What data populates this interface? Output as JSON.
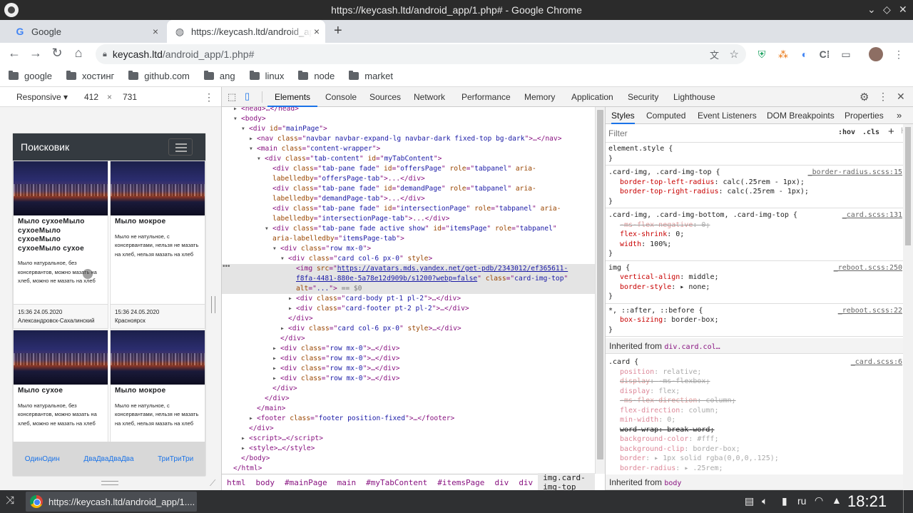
{
  "window": {
    "title": "https://keycash.ltd/android_app/1.php# - Google Chrome"
  },
  "tabs": [
    {
      "label": "Google",
      "close": "×"
    },
    {
      "label": "https://keycash.ltd/android_app/1.php#",
      "close": "×"
    }
  ],
  "new_tab": "+",
  "address": {
    "host": "keycash.ltd",
    "path": "/android_app/1.php#"
  },
  "bookmarks": [
    "google",
    "хостинг",
    "github.com",
    "ang",
    "linux",
    "node",
    "market"
  ],
  "device": {
    "mode": "Responsive",
    "width": "412",
    "x": "×",
    "height": "731"
  },
  "phone": {
    "brand": "Поисковик",
    "cards": [
      {
        "title": "Мыло сухоеМыло сухоеМыло сухоеМыло сухоеМыло сухое",
        "text": "Мыло натуральное, без консервантов, можно мазать на хлеб, можно не мазать на хлеб",
        "date": "15:36 24.05.2020",
        "city": "Александровск-Сахалинский"
      },
      {
        "title": "Мыло мокрое",
        "text": "Мыло не натульное, с консервантами, нельзя не мазать на хлеб, нельзя мазать на хлеб",
        "date": "15:36 24.05.2020",
        "city": "Красноярск"
      },
      {
        "title": "Мыло сухое",
        "text": "Мыло натуральное, без консервантов, можно мазать на хлеб, можно не мазать на хлеб"
      },
      {
        "title": "Мыло мокрое",
        "text": "Мыло не натульное, с консервантами, нельзя не мазать на хлеб, нельзя мазать на хлеб"
      }
    ],
    "bottom_links": [
      "ОдинОдин",
      "ДваДваДваДва",
      "ТриТриТри"
    ]
  },
  "devtools": {
    "tabs": [
      "Elements",
      "Console",
      "Sources",
      "Network",
      "Performance",
      "Memory",
      "Application",
      "Security",
      "Lighthouse"
    ],
    "active_tab": "Elements",
    "dom_lines": [
      {
        "i": 0,
        "tri": "▸",
        "html": "<span class='t'>&lt;head&gt;</span>…<span class='t'>&lt;/head&gt;</span>"
      },
      {
        "i": 0,
        "tri": "▾",
        "html": "<span class='t'>&lt;body&gt;</span>"
      },
      {
        "i": 1,
        "tri": "▾",
        "html": "<span class='t'>&lt;div </span><span class='an'>id</span>=\"<span class='av'>mainPage</span>\"<span class='t'>&gt;</span>"
      },
      {
        "i": 2,
        "tri": "▸",
        "html": "<span class='t'>&lt;nav </span><span class='an'>class</span>=\"<span class='av'>navbar navbar-expand-lg navbar-dark fixed-top bg-dark</span>\"<span class='t'>&gt;</span>…<span class='t'>&lt;/nav&gt;</span>"
      },
      {
        "i": 2,
        "tri": "▾",
        "html": "<span class='t'>&lt;main </span><span class='an'>class</span>=\"<span class='av'>content-wrapper</span>\"<span class='t'>&gt;</span>"
      },
      {
        "i": 3,
        "tri": "▾",
        "html": "<span class='t'>&lt;div </span><span class='an'>class</span>=\"<span class='av'>tab-content</span>\" <span class='an'>id</span>=\"<span class='av'>myTabContent</span>\"<span class='t'>&gt;</span>"
      },
      {
        "i": 4,
        "tri": "",
        "html": "<span class='t'>&lt;div </span><span class='an'>class</span>=\"<span class='av'>tab-pane fade</span>\" <span class='an'>id</span>=\"<span class='av'>offersPage</span>\" <span class='an'>role</span>=\"<span class='av'>tabpanel</span>\" <span class='an'>aria-</span>"
      },
      {
        "i": 4,
        "tri": "",
        "html": "<span class='an'>labelledby</span>=\"<span class='av'>offersPage-tab</span>\"<span class='t'>&gt;</span>...<span class='t'>&lt;/div&gt;</span>"
      },
      {
        "i": 4,
        "tri": "",
        "html": "<span class='t'>&lt;div </span><span class='an'>class</span>=\"<span class='av'>tab-pane fade</span>\" <span class='an'>id</span>=\"<span class='av'>demandPage</span>\" <span class='an'>role</span>=\"<span class='av'>tabpanel</span>\" <span class='an'>aria-</span>"
      },
      {
        "i": 4,
        "tri": "",
        "html": "<span class='an'>labelledby</span>=\"<span class='av'>demandPage-tab</span>\"<span class='t'>&gt;</span>...<span class='t'>&lt;/div&gt;</span>"
      },
      {
        "i": 4,
        "tri": "",
        "html": "<span class='t'>&lt;div </span><span class='an'>class</span>=\"<span class='av'>tab-pane fade</span>\" <span class='an'>id</span>=\"<span class='av'>intersectionPage</span>\" <span class='an'>role</span>=\"<span class='av'>tabpanel</span>\" <span class='an'>aria-</span>"
      },
      {
        "i": 4,
        "tri": "",
        "html": "<span class='an'>labelledby</span>=\"<span class='av'>intersectionPage-tab</span>\"<span class='t'>&gt;</span>...<span class='t'>&lt;/div&gt;</span>"
      },
      {
        "i": 4,
        "tri": "▾",
        "html": "<span class='t'>&lt;div </span><span class='an'>class</span>=\"<span class='av'>tab-pane fade active show</span>\" <span class='an'>id</span>=\"<span class='av'>itemsPage</span>\" <span class='an'>role</span>=\"<span class='av'>tabpanel</span>\""
      },
      {
        "i": 4,
        "tri": "",
        "html": "<span class='an'>aria-labelledby</span>=\"<span class='av'>itemsPage-tab</span>\"<span class='t'>&gt;</span>"
      },
      {
        "i": 5,
        "tri": "▾",
        "html": "<span class='t'>&lt;div </span><span class='an'>class</span>=\"<span class='av'>row mx-0</span>\"<span class='t'>&gt;</span>"
      },
      {
        "i": 6,
        "tri": "▾",
        "html": "<span class='t'>&lt;div </span><span class='an'>class</span>=\"<span class='av'>card col-6 px-0</span>\" <span class='an'>style</span><span class='t'>&gt;</span>"
      },
      {
        "i": 7,
        "tri": "",
        "sel": true,
        "html": "<span class='t'>&lt;img </span><span class='an'>src</span>=\"<span class='lnk'>https://avatars.mds.yandex.net/get-pdb/2343012/ef365611-</span>"
      },
      {
        "i": 7,
        "tri": "",
        "sel": true,
        "html": "<span class='lnk'>f8fa-4481-880e-5a78e12d909b/s1200?webp=false</span>\" <span class='an'>class</span>=\"<span class='av'>card-img-top</span>\""
      },
      {
        "i": 7,
        "tri": "",
        "sel": true,
        "html": "<span class='an'>alt</span>=\"<span class='av'>...</span>\"<span class='t'>&gt;</span> <span style='color:#777'>== $0</span>"
      },
      {
        "i": 7,
        "tri": "▸",
        "html": "<span class='t'>&lt;div </span><span class='an'>class</span>=\"<span class='av'>card-body pt-1 pl-2</span>\"<span class='t'>&gt;</span>…<span class='t'>&lt;/div&gt;</span>"
      },
      {
        "i": 7,
        "tri": "▸",
        "html": "<span class='t'>&lt;div </span><span class='an'>class</span>=\"<span class='av'>card-footer pt-2 pl-2</span>\"<span class='t'>&gt;</span>…<span class='t'>&lt;/div&gt;</span>"
      },
      {
        "i": 6,
        "tri": "",
        "html": "<span class='t'>&lt;/div&gt;</span>"
      },
      {
        "i": 6,
        "tri": "▸",
        "html": "<span class='t'>&lt;div </span><span class='an'>class</span>=\"<span class='av'>card col-6 px-0</span>\" <span class='an'>style</span><span class='t'>&gt;</span>…<span class='t'>&lt;/div&gt;</span>"
      },
      {
        "i": 5,
        "tri": "",
        "html": "<span class='t'>&lt;/div&gt;</span>"
      },
      {
        "i": 5,
        "tri": "▸",
        "html": "<span class='t'>&lt;div </span><span class='an'>class</span>=\"<span class='av'>row mx-0</span>\"<span class='t'>&gt;</span>…<span class='t'>&lt;/div&gt;</span>"
      },
      {
        "i": 5,
        "tri": "▸",
        "html": "<span class='t'>&lt;div </span><span class='an'>class</span>=\"<span class='av'>row mx-0</span>\"<span class='t'>&gt;</span>…<span class='t'>&lt;/div&gt;</span>"
      },
      {
        "i": 5,
        "tri": "▸",
        "html": "<span class='t'>&lt;div </span><span class='an'>class</span>=\"<span class='av'>row mx-0</span>\"<span class='t'>&gt;</span>…<span class='t'>&lt;/div&gt;</span>"
      },
      {
        "i": 5,
        "tri": "▸",
        "html": "<span class='t'>&lt;div </span><span class='an'>class</span>=\"<span class='av'>row mx-0</span>\"<span class='t'>&gt;</span>…<span class='t'>&lt;/div&gt;</span>"
      },
      {
        "i": 4,
        "tri": "",
        "html": "<span class='t'>&lt;/div&gt;</span>"
      },
      {
        "i": 3,
        "tri": "",
        "html": "<span class='t'>&lt;/div&gt;</span>"
      },
      {
        "i": 2,
        "tri": "",
        "html": "<span class='t'>&lt;/main&gt;</span>"
      },
      {
        "i": 2,
        "tri": "▸",
        "html": "<span class='t'>&lt;footer </span><span class='an'>class</span>=\"<span class='av'>footer position-fixed</span>\"<span class='t'>&gt;</span>…<span class='t'>&lt;/footer&gt;</span>"
      },
      {
        "i": 1,
        "tri": "",
        "html": "<span class='t'>&lt;/div&gt;</span>"
      },
      {
        "i": 1,
        "tri": "▸",
        "html": "<span class='t'>&lt;script&gt;</span>…<span class='t'>&lt;/script&gt;</span>"
      },
      {
        "i": 1,
        "tri": "▸",
        "html": "<span class='t'>&lt;style&gt;</span>…<span class='t'>&lt;/style&gt;</span>"
      },
      {
        "i": 0,
        "tri": "",
        "html": "<span class='t'>&lt;/body&gt;</span>"
      },
      {
        "i": -1,
        "tri": "",
        "html": "<span class='t'>&lt;/html&gt;</span>"
      }
    ],
    "breadcrumb": [
      "html",
      "body",
      "#mainPage",
      "main",
      "#myTabContent",
      "#itemsPage",
      "div",
      "div",
      "img.card-img-top"
    ],
    "styles_tabs": [
      "Styles",
      "Computed",
      "Event Listeners",
      "DOM Breakpoints",
      "Properties"
    ],
    "filter_placeholder": "Filter",
    "hov": ":hov",
    "cls": ".cls",
    "rules": [
      {
        "sel": "element.style {",
        "src": "",
        "props": [],
        "end": "}"
      },
      {
        "sel": ".card-img, .card-img-top {",
        "src": "_border-radius.scss:15",
        "props": [
          {
            "n": "border-top-left-radius",
            "v": "calc(.25rem - 1px);"
          },
          {
            "n": "border-top-right-radius",
            "v": "calc(.25rem - 1px);"
          }
        ],
        "end": "}"
      },
      {
        "sel": ".card-img, .card-img-bottom, .card-img-top {",
        "src": "_card.scss:131",
        "props": [
          {
            "n": "-ms-flex-negative",
            "v": "0;",
            "s": "strike"
          },
          {
            "n": "flex-shrink",
            "v": "0;"
          },
          {
            "n": "width",
            "v": "100%;"
          }
        ],
        "end": "}"
      },
      {
        "sel": "img {",
        "src": "_reboot.scss:250",
        "props": [
          {
            "n": "vertical-align",
            "v": "middle;"
          },
          {
            "n": "border-style",
            "v": "▸ none;"
          }
        ],
        "end": "}"
      },
      {
        "sel": "*, ::after, ::before {",
        "src": "_reboot.scss:22",
        "props": [
          {
            "n": "box-sizing",
            "v": "border-box;"
          }
        ],
        "end": "}"
      }
    ],
    "inherited_label": "Inherited from",
    "inherited_from": "div.card.col…",
    "card_rule": {
      "sel": ".card {",
      "src": "_card.scss:6",
      "props": [
        {
          "n": "position",
          "v": "relative;",
          "s": "dim"
        },
        {
          "n": "display",
          "v": "-ms-flexbox;",
          "s": "strike"
        },
        {
          "n": "display",
          "v": "flex;",
          "s": "dim"
        },
        {
          "n": "-ms-flex-direction",
          "v": "column;",
          "s": "strike"
        },
        {
          "n": "flex-direction",
          "v": "column;",
          "s": "dim"
        },
        {
          "n": "min-width",
          "v": "0;",
          "s": "dim"
        },
        {
          "n": "word-wrap",
          "v": "break-word;",
          "s": "strikeblack"
        },
        {
          "n": "background-color",
          "v": "#fff;",
          "s": "dim"
        },
        {
          "n": "background-clip",
          "v": "border-box;",
          "s": "dim"
        },
        {
          "n": "border",
          "v": "▸ 1px solid rgba(0,0,0,.125);",
          "s": "dim"
        },
        {
          "n": "border-radius",
          "v": "▸ .25rem;",
          "s": "dim"
        }
      ]
    },
    "inherited2_label": "Inherited from",
    "inherited2_from": "body"
  },
  "taskbar": {
    "item": "https://keycash.ltd/android_app/1....",
    "lang": "ru",
    "clock": "18:21"
  }
}
